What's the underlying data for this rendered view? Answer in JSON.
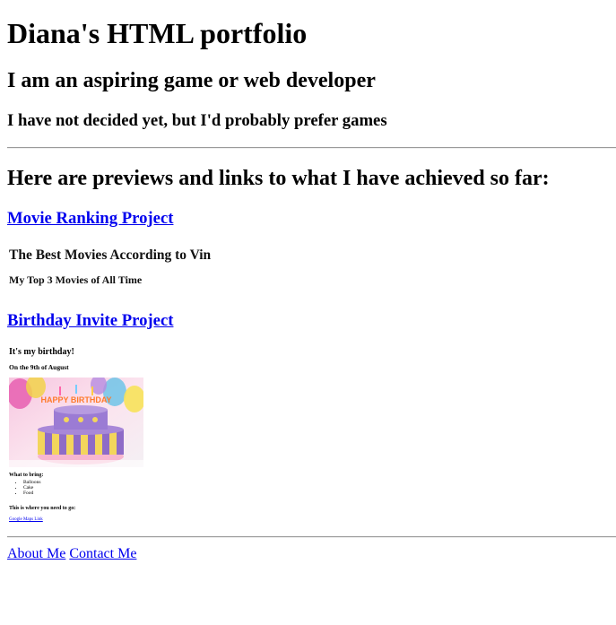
{
  "header": {
    "title": "Diana's HTML portfolio",
    "tagline": "I am an aspiring game or web developer",
    "subtitle": "I have not decided yet, but I'd probably prefer games"
  },
  "main": {
    "intro": "Here are previews and links to what I have achieved so far:",
    "projects": [
      {
        "link_label": "Movie Ranking Project",
        "preview": {
          "heading": "The Best Movies According to Vin",
          "subheading": "My Top 3 Movies of All Time"
        }
      },
      {
        "link_label": "Birthday Invite Project",
        "preview": {
          "heading": "It's my birthday!",
          "date": "On the 9th of August",
          "cake_text": "HAPPY BIRTHDAY",
          "bring_heading": "What to bring:",
          "bring_items": [
            "Balloons",
            "Cake",
            "Food"
          ],
          "location_heading": "This is where you need to go:",
          "map_link": "Google Maps Link"
        }
      }
    ]
  },
  "footer": {
    "about_label": "About Me",
    "contact_label": "Contact Me"
  },
  "colors": {
    "link": "#0000ee",
    "divider": "#9a9a9a"
  }
}
